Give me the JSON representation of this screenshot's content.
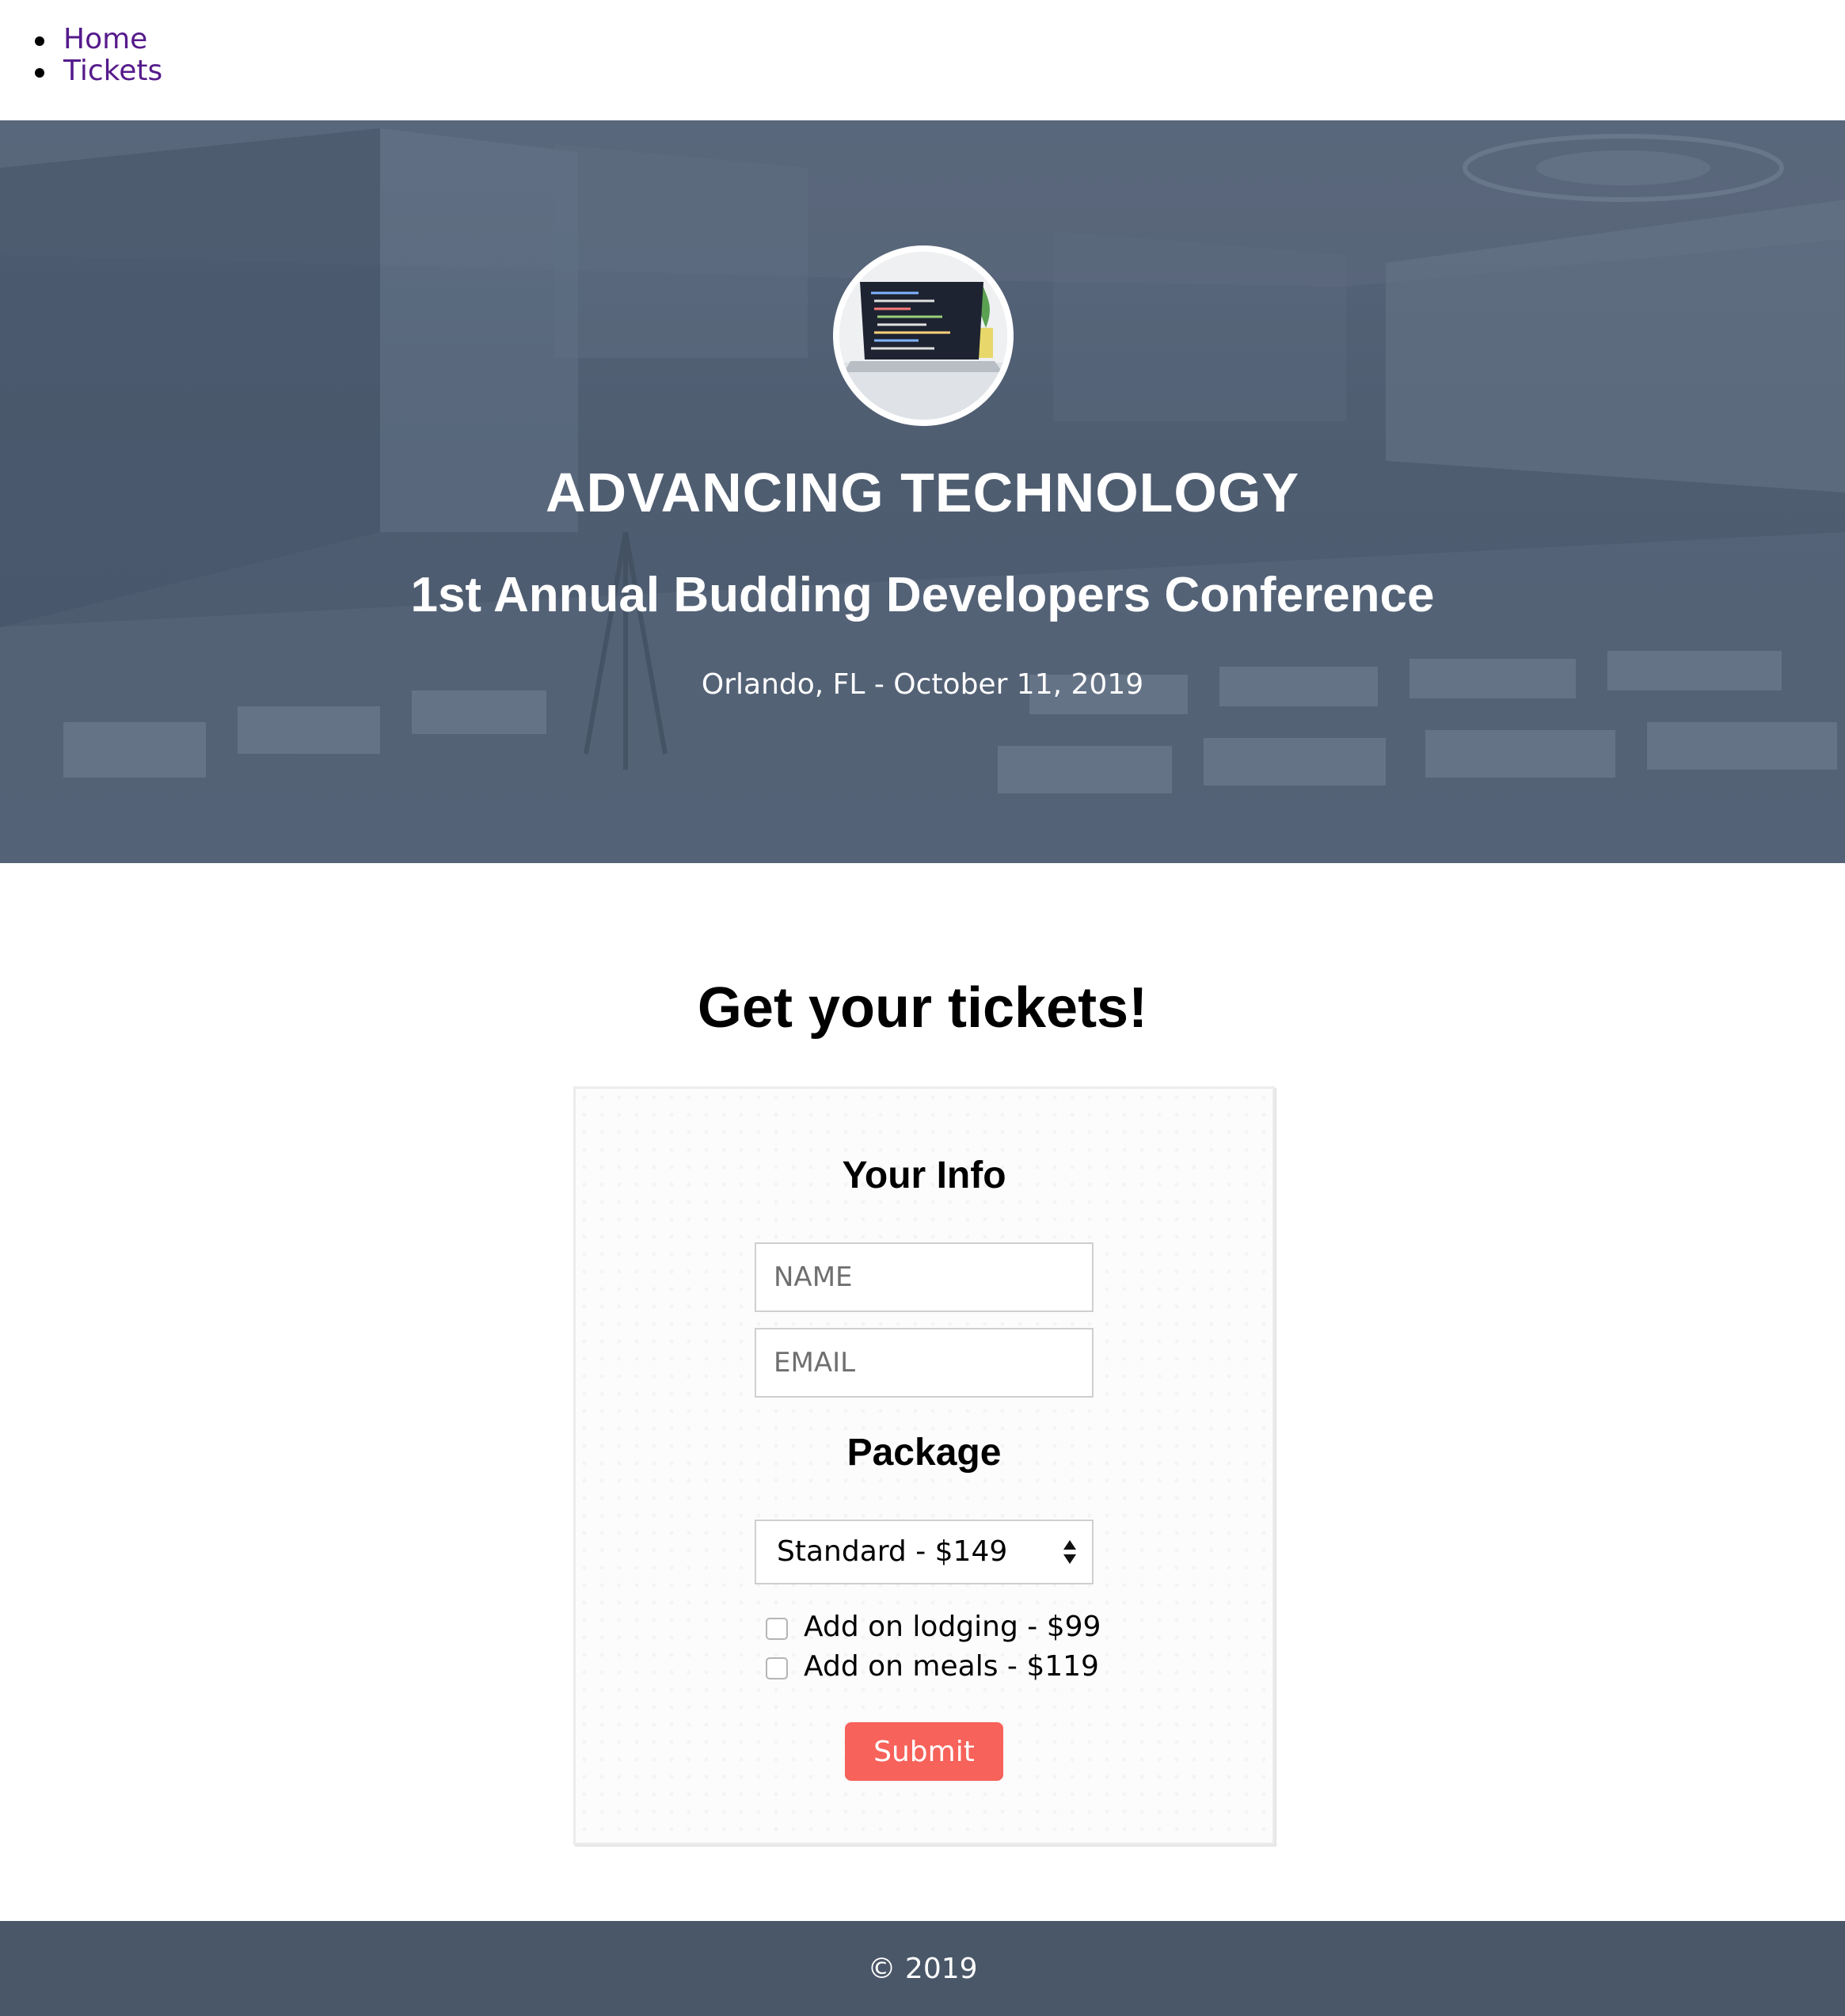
{
  "nav": {
    "items": [
      {
        "label": "Home"
      },
      {
        "label": "Tickets"
      }
    ]
  },
  "hero": {
    "title": "ADVANCING TECHNOLOGY",
    "subtitle": "1st Annual Budding Developers Conference",
    "meta": "Orlando, FL - October 11, 2019",
    "avatar_icon": "laptop-code-photo"
  },
  "tickets": {
    "heading": "Get your tickets!",
    "info_title": "Your Info",
    "name_placeholder": "NAME",
    "email_placeholder": "EMAIL",
    "package_title": "Package",
    "package_selected": "Standard - $149",
    "addons": [
      {
        "label": "Add on lodging - $99",
        "checked": false
      },
      {
        "label": "Add on meals - $119",
        "checked": false
      }
    ],
    "submit_label": "Submit"
  },
  "colors": {
    "link": "#551a8b",
    "hero_overlay": "#4f5d71",
    "accent": "#f7625a",
    "footer": "#4a5768"
  },
  "footer": {
    "text": "© 2019"
  }
}
